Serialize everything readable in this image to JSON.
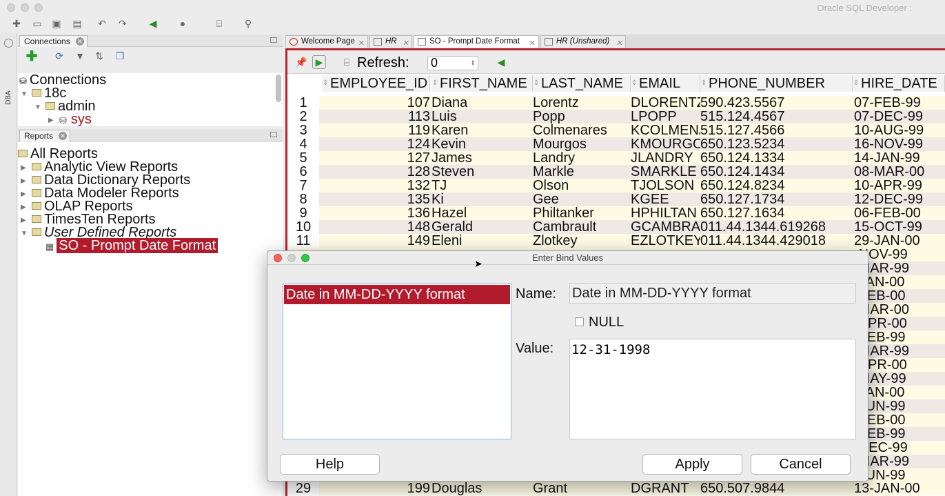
{
  "app": {
    "title": "Oracle SQL Developer :"
  },
  "left": {
    "connections_tab": "Connections",
    "connections": [
      "Connections",
      "18c",
      "admin",
      "sys"
    ],
    "reports_tab": "Reports",
    "dba_label": "DBA",
    "reports": [
      "All Reports",
      "Analytic View Reports",
      "Data Dictionary Reports",
      "Data Modeler Reports",
      "OLAP Reports",
      "TimesTen Reports",
      "User Defined Reports",
      "SO - Prompt Date Format"
    ]
  },
  "editor": {
    "tabs": [
      "Welcome Page",
      "HR",
      "SO - Prompt Date Format",
      "HR (Unshared)"
    ],
    "refresh_label": "Refresh:",
    "refresh_value": "0",
    "columns": [
      "EMPLOYEE_ID",
      "FIRST_NAME",
      "LAST_NAME",
      "EMAIL",
      "PHONE_NUMBER",
      "HIRE_DATE"
    ],
    "rows": [
      [
        "1",
        "107",
        "Diana",
        "Lorentz",
        "DLORENTZ",
        "590.423.5567",
        "07-FEB-99"
      ],
      [
        "2",
        "113",
        "Luis",
        "Popp",
        "LPOPP",
        "515.124.4567",
        "07-DEC-99"
      ],
      [
        "3",
        "119",
        "Karen",
        "Colmenares",
        "KCOLMENA",
        "515.127.4566",
        "10-AUG-99"
      ],
      [
        "4",
        "124",
        "Kevin",
        "Mourgos",
        "KMOURGOS",
        "650.123.5234",
        "16-NOV-99"
      ],
      [
        "5",
        "127",
        "James",
        "Landry",
        "JLANDRY",
        "650.124.1334",
        "14-JAN-99"
      ],
      [
        "6",
        "128",
        "Steven",
        "Markle",
        "SMARKLE",
        "650.124.1434",
        "08-MAR-00"
      ],
      [
        "7",
        "132",
        "TJ",
        "Olson",
        "TJOLSON",
        "650.124.8234",
        "10-APR-99"
      ],
      [
        "8",
        "135",
        "Ki",
        "Gee",
        "KGEE",
        "650.127.1734",
        "12-DEC-99"
      ],
      [
        "9",
        "136",
        "Hazel",
        "Philtanker",
        "HPHILTAN",
        "650.127.1634",
        "06-FEB-00"
      ],
      [
        "10",
        "148",
        "Gerald",
        "Cambrault",
        "GCAMBRAU",
        "011.44.1344.619268",
        "15-OCT-99"
      ],
      [
        "11",
        "149",
        "Eleni",
        "Zlotkey",
        "EZLOTKEY",
        "011.44.1344.429018",
        "29-JAN-00"
      ]
    ],
    "hidden_dates": [
      "-NOV-99",
      "-MAR-99",
      "-JAN-00",
      "-FEB-00",
      "-MAR-00",
      "-APR-00",
      "-FEB-99",
      "-MAR-99",
      "-APR-00",
      "-MAY-99",
      "-JAN-00",
      "-JUN-99",
      "-FEB-00",
      "-FEB-99",
      "-DEC-99",
      "-MAR-99",
      "-JUN-99"
    ],
    "last_row": [
      "29",
      "199",
      "Douglas",
      "Grant",
      "DGRANT",
      "650.507.9844",
      "13-JAN-00"
    ]
  },
  "dialog": {
    "title": "Enter Bind Values",
    "list_item": "Date in MM-DD-YYYY format",
    "name_label": "Name:",
    "name_value": "Date in MM-DD-YYYY format",
    "null_label": "NULL",
    "value_label": "Value:",
    "value": "12-31-1998",
    "help": "Help",
    "apply": "Apply",
    "cancel": "Cancel"
  }
}
